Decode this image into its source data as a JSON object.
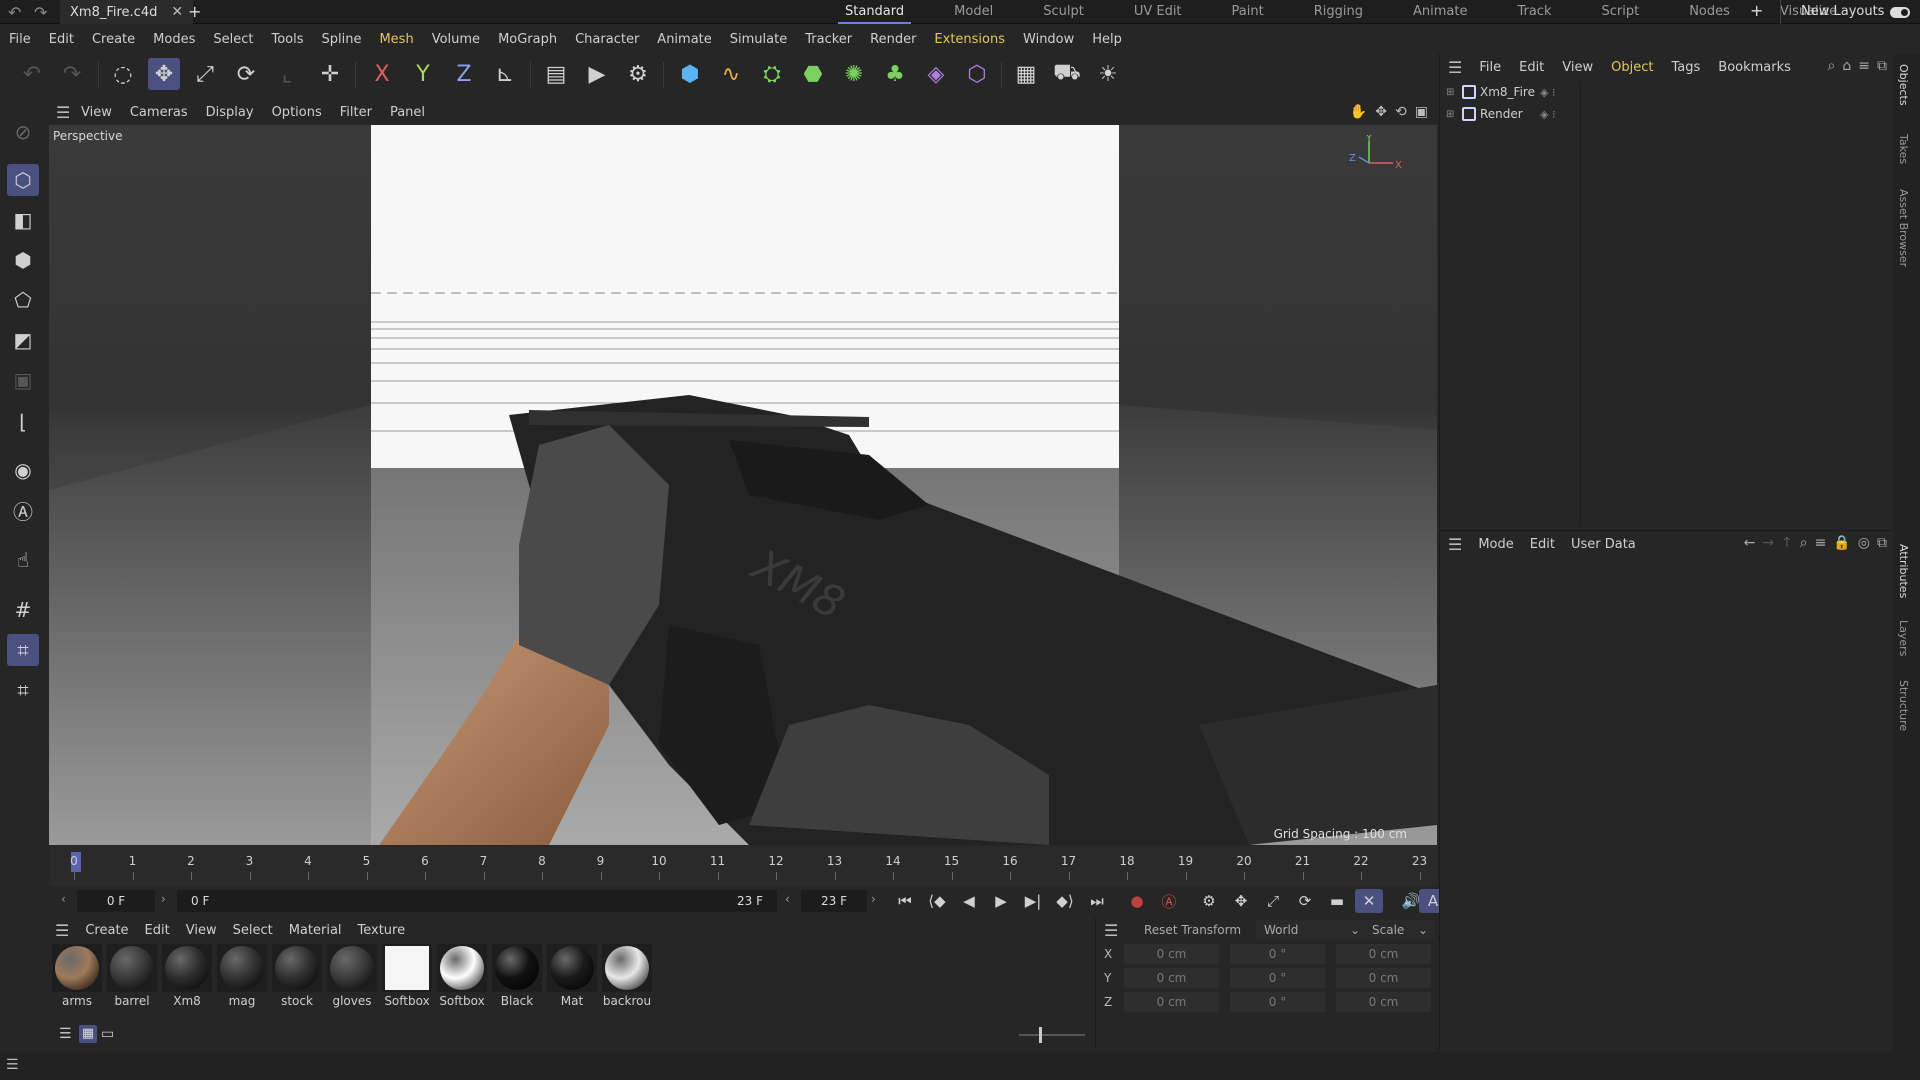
{
  "titlebar": {
    "file_tab": "Xm8_Fire.c4d",
    "layouts": [
      "Standard",
      "Model",
      "Sculpt",
      "UV Edit",
      "Paint",
      "Rigging",
      "Animate",
      "Track",
      "Script",
      "Nodes",
      "Visualize"
    ],
    "active_layout": "Standard",
    "new_layouts": "New Layouts"
  },
  "menubar": [
    "File",
    "Edit",
    "Create",
    "Modes",
    "Select",
    "Tools",
    "Spline",
    "Mesh",
    "Volume",
    "MoGraph",
    "Character",
    "Animate",
    "Simulate",
    "Tracker",
    "Render",
    "Extensions",
    "Window",
    "Help"
  ],
  "viewport": {
    "menu": [
      "View",
      "Cameras",
      "Display",
      "Options",
      "Filter",
      "Panel"
    ],
    "label": "Perspective",
    "grid_spacing": "Grid Spacing : 100 cm",
    "axis_labels": {
      "x": "X",
      "y": "Y",
      "z": "Z"
    }
  },
  "timeline": {
    "ticks": [
      "0",
      "1",
      "2",
      "3",
      "4",
      "5",
      "6",
      "7",
      "8",
      "9",
      "10",
      "11",
      "12",
      "13",
      "14",
      "15",
      "16",
      "17",
      "18",
      "19",
      "20",
      "21",
      "22",
      "23"
    ],
    "current_frame": "0 F",
    "range_start": "0 F",
    "range_end": "23 F",
    "end_frame": "23 F"
  },
  "materials": {
    "menu": [
      "Create",
      "Edit",
      "View",
      "Select",
      "Material",
      "Texture"
    ],
    "items": [
      {
        "name": "arms",
        "color": "#a07a5a"
      },
      {
        "name": "barrel",
        "color": "#3a3a3a"
      },
      {
        "name": "Xm8",
        "color": "#2e2e2e"
      },
      {
        "name": "mag",
        "color": "#333333"
      },
      {
        "name": "stock",
        "color": "#303030"
      },
      {
        "name": "gloves",
        "color": "#3c3c3c"
      },
      {
        "name": "Softbox",
        "color": "#f5f5f5"
      },
      {
        "name": "Softbox",
        "color": "#ffffff"
      },
      {
        "name": "Black",
        "color": "#111111"
      },
      {
        "name": "Mat",
        "color": "#1a1a1a"
      },
      {
        "name": "backrou",
        "color": "#e8e8e8"
      }
    ]
  },
  "coords": {
    "reset_label": "Reset Transform",
    "space": "World",
    "mode": "Scale",
    "rows": [
      {
        "axis": "X",
        "pos": "0 cm",
        "rot": "0 °",
        "scale": "0 cm"
      },
      {
        "axis": "Y",
        "pos": "0 cm",
        "rot": "0 °",
        "scale": "0 cm"
      },
      {
        "axis": "Z",
        "pos": "0 cm",
        "rot": "0 °",
        "scale": "0 cm"
      }
    ]
  },
  "objects": {
    "menu": [
      "File",
      "Edit",
      "View",
      "Object",
      "Tags",
      "Bookmarks"
    ],
    "active_menu": "Object",
    "items": [
      "Xm8_Fire",
      "Render"
    ]
  },
  "attributes": {
    "menu": [
      "Mode",
      "Edit",
      "User Data"
    ]
  },
  "side_tabs": [
    "Objects",
    "Takes",
    "Asset Browser",
    "Attributes",
    "Layers",
    "Structure"
  ],
  "accent_color": "#4a5180"
}
